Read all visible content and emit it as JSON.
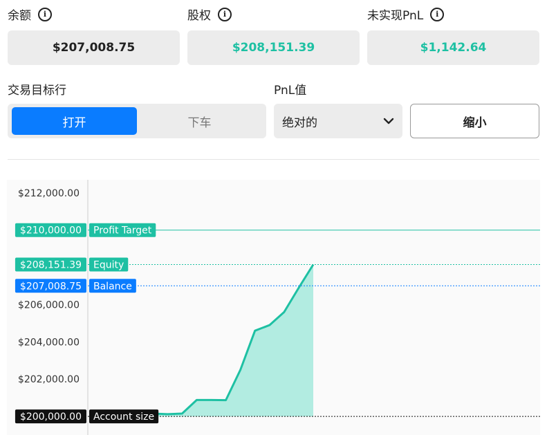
{
  "stats": {
    "balance": {
      "label": "余额",
      "value": "$207,008.75",
      "color": "#222222"
    },
    "equity": {
      "label": "股权",
      "value": "$208,151.39",
      "color": "#1ec0a3"
    },
    "unrealized_pnl": {
      "label": "未实现PnL",
      "value": "$1,142.64",
      "color": "#1ec0a3"
    }
  },
  "trade_target": {
    "label": "交易目标行",
    "options": [
      "打开",
      "下车"
    ],
    "selected": "打开"
  },
  "pnl_value": {
    "label": "PnL值",
    "selected": "绝对的"
  },
  "zoom_button": "缩小",
  "colors": {
    "accent_blue": "#0a7cff",
    "teal": "#1ec0a3",
    "fill": "#b2ece1",
    "black_label": "#111111"
  },
  "chart_data": {
    "type": "area",
    "ylim": [
      199000,
      212700
    ],
    "y_ticks": [
      {
        "value": 212000,
        "label": "$212,000.00"
      },
      {
        "value": 206000,
        "label": "$206,000.00"
      },
      {
        "value": 204000,
        "label": "$204,000.00"
      },
      {
        "value": 202000,
        "label": "$202,000.00"
      }
    ],
    "series": [
      {
        "values": [
          200250,
          200220,
          200180,
          200150,
          200120,
          200150,
          200880,
          200880,
          200870,
          202500,
          204600,
          204900,
          205600,
          206900,
          208151.39
        ]
      }
    ],
    "lines": [
      {
        "value": 210000,
        "price_label": "$210,000.00",
        "name": "Profit Target",
        "color": "#1ec0a3",
        "style": "solid"
      },
      {
        "value": 208151.39,
        "price_label": "$208,151.39",
        "name": "Equity",
        "color": "#1ec0a3",
        "style": "dotted"
      },
      {
        "value": 207008.75,
        "price_label": "$207,008.75",
        "name": "Balance",
        "color": "#0a7cff",
        "style": "dotted"
      },
      {
        "value": 200000,
        "price_label": "$200,000.00",
        "name": "Account size",
        "color": "#111111",
        "style": "dotted"
      }
    ],
    "grid": false
  }
}
